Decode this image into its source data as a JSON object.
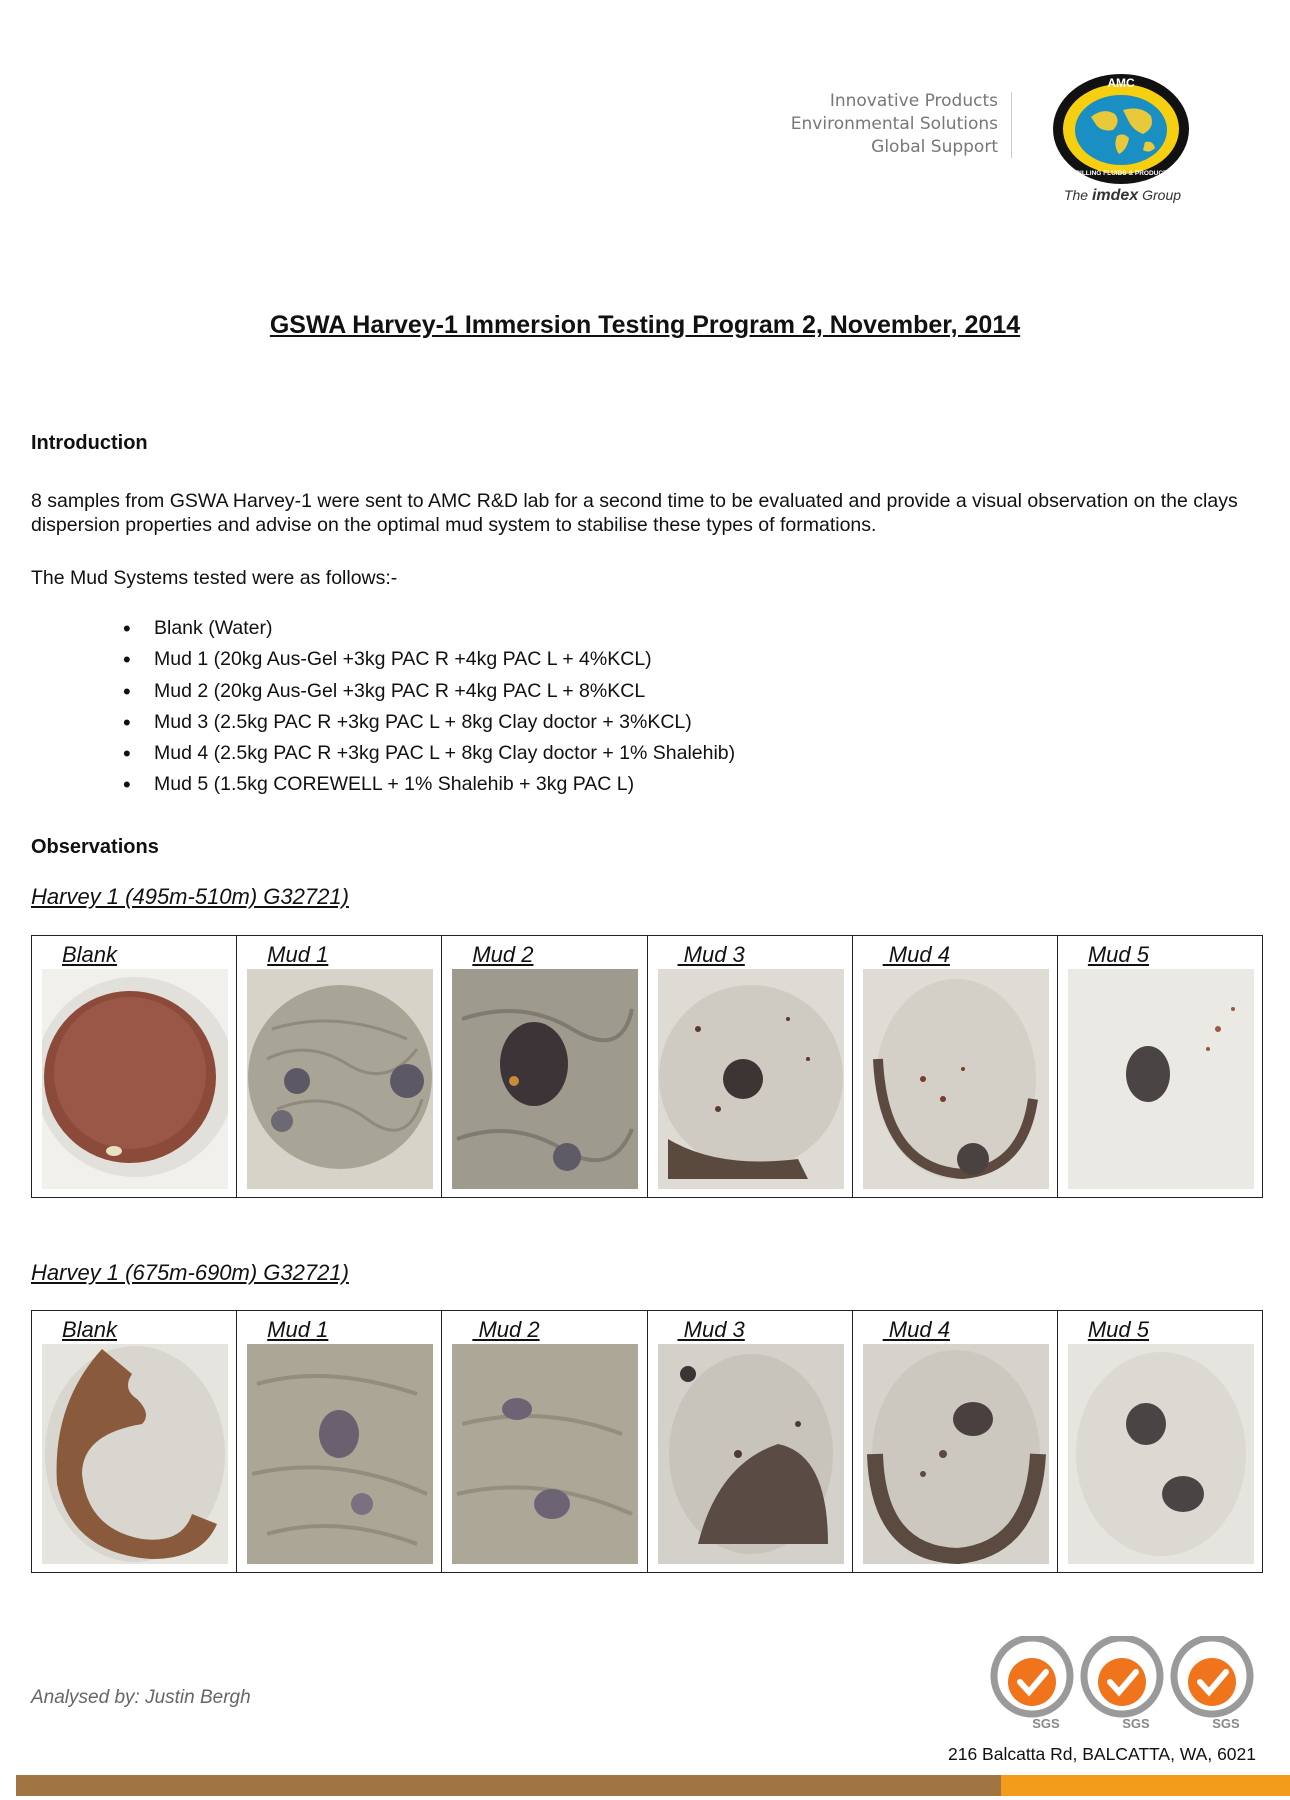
{
  "header": {
    "tagline": [
      "Innovative Products",
      "Environmental Solutions",
      "Global Support"
    ],
    "logo_text": "AMC",
    "logo_ring_text": "DRILLING FLUIDS & PRODUCTS",
    "group_prefix": "The",
    "group_brand": "imdex",
    "group_suffix": "Group"
  },
  "title": "GSWA Harvey-1 Immersion Testing Program 2, November, 2014",
  "introduction": {
    "heading": "Introduction",
    "paragraph": "8 samples from GSWA Harvey-1 were sent to AMC R&D lab for a second time to be evaluated and provide a visual observation on the clays dispersion properties and advise on the optimal mud system to stabilise these types of formations.",
    "lead": "The Mud Systems tested were as follows:-"
  },
  "mud_systems": [
    "Blank (Water)",
    "Mud 1 (20kg Aus-Gel +3kg PAC R +4kg PAC L + 4%KCL)",
    "Mud 2 (20kg Aus-Gel +3kg PAC R +4kg PAC L + 8%KCL",
    "Mud 3 (2.5kg PAC R +3kg PAC L + 8kg Clay doctor + 3%KCL)",
    "Mud 4 (2.5kg PAC R +3kg PAC L + 8kg Clay doctor + 1% Shalehib)",
    "Mud 5 (1.5kg COREWELL + 1% Shalehib + 3kg PAC L)"
  ],
  "observations_heading": "Observations",
  "samples": [
    {
      "title": "Harvey 1 (495m-510m) G32721)",
      "labels": [
        "Blank",
        "Mud 1",
        "Mud 2",
        " Mud 3",
        " Mud 4",
        "Mud 5"
      ]
    },
    {
      "title": "Harvey 1 (675m-690m) G32721)",
      "labels": [
        "Blank",
        "Mud 1",
        " Mud 2",
        " Mud 3",
        " Mud 4",
        "Mud 5"
      ]
    }
  ],
  "footer": {
    "analysed_by": "Analysed by: Justin Bergh",
    "address": "216 Balcatta Rd, BALCATTA, WA, 6021",
    "cert_label": "SGS",
    "cert_count": 3
  },
  "colors": {
    "footer_bar_brown": "#a07542",
    "footer_bar_orange": "#f39c1c",
    "cert_orange": "#f0741c"
  }
}
